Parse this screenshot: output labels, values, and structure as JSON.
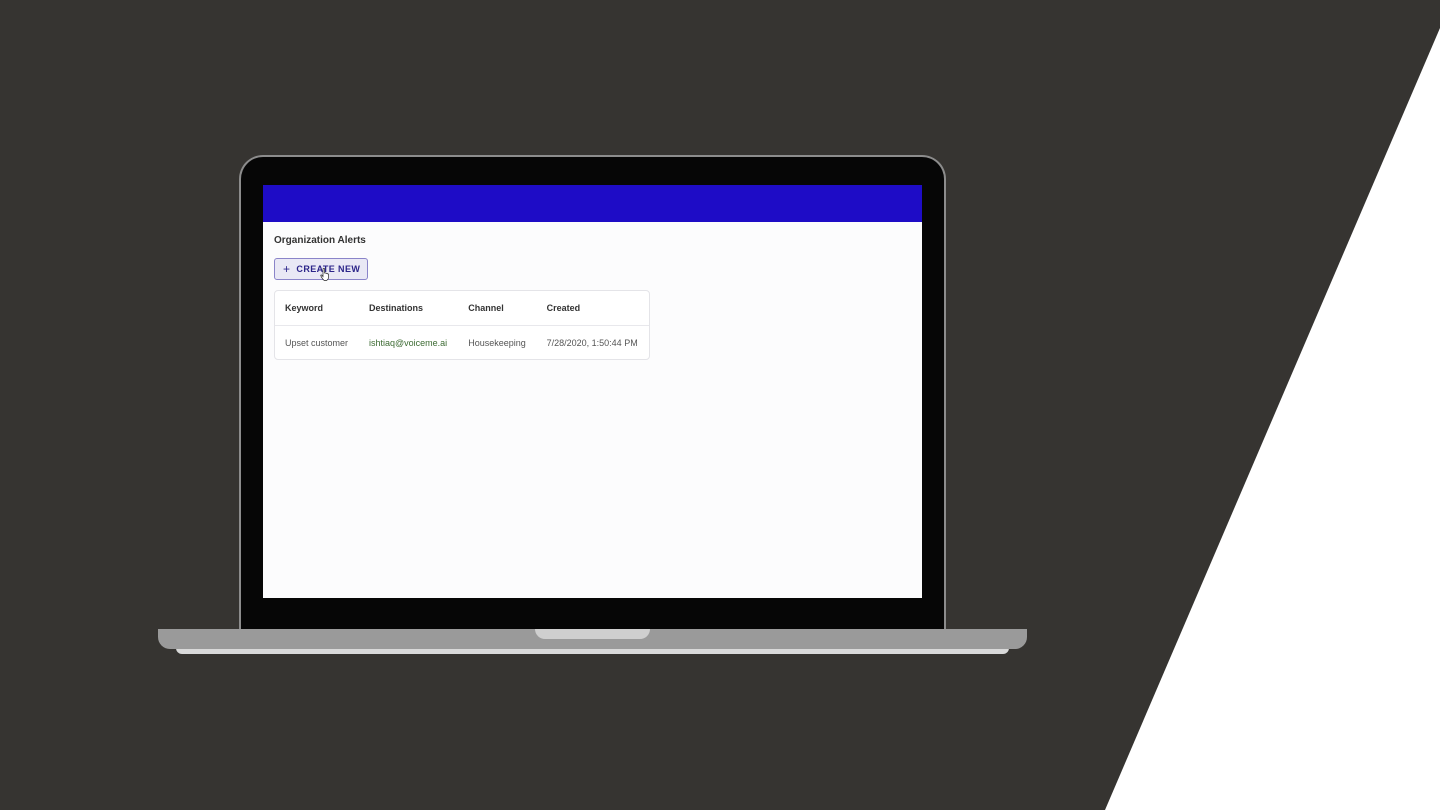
{
  "page": {
    "title": "Organization Alerts"
  },
  "toolbar": {
    "create_label": "CREATE NEW",
    "create_icon": "plus-icon"
  },
  "table": {
    "headers": [
      "Keyword",
      "Destinations",
      "Channel",
      "Created"
    ],
    "rows": [
      {
        "keyword": "Upset customer",
        "destination": "ishtiaq@voiceme.ai",
        "channel": "Housekeeping",
        "created": "7/28/2020, 1:50:44 PM"
      }
    ]
  },
  "colors": {
    "app_bar": "#1e0cc6",
    "background": "#363431",
    "accent_text": "#2b2489",
    "email_text": "#3d6b33"
  }
}
